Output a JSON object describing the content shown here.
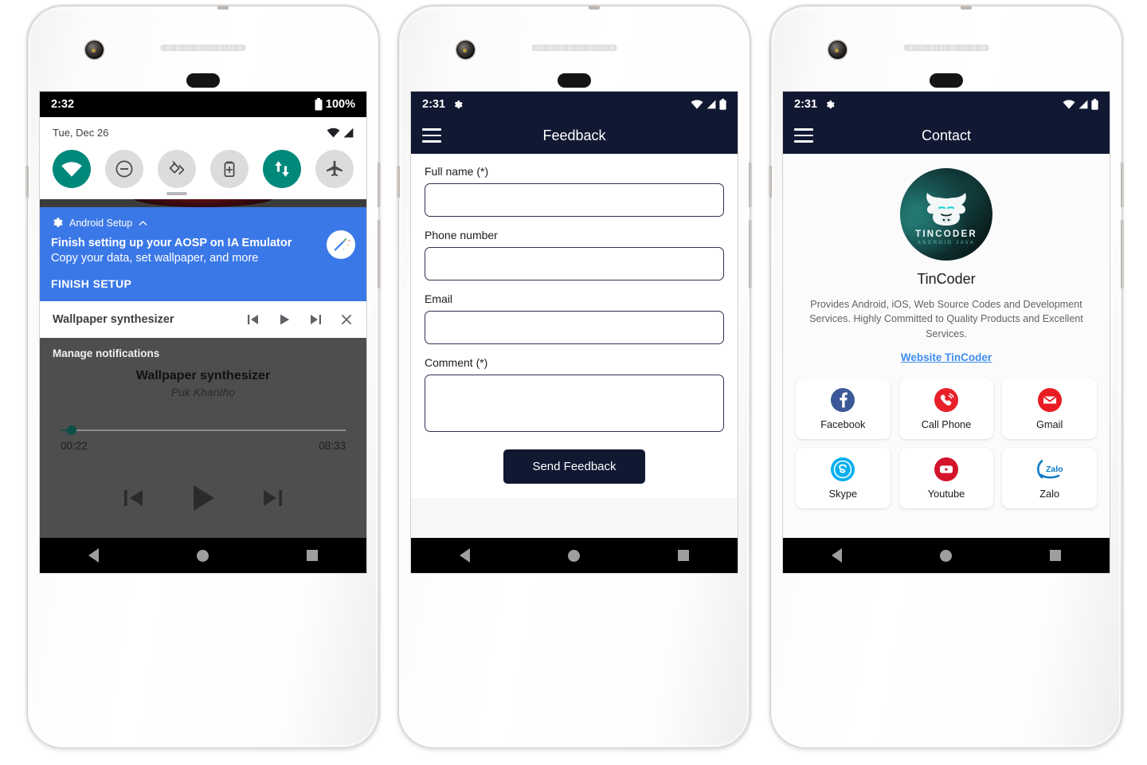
{
  "phone1": {
    "status": {
      "time": "2:32",
      "battery_text": "100%",
      "battery_icon": "battery-full-icon"
    },
    "quick_settings": {
      "date": "Tue, Dec 26",
      "wifi_icon": "wifi-icon",
      "signal_icon": "cell-signal-icon",
      "tiles": [
        {
          "name": "wifi-tile",
          "icon": "wifi-icon",
          "active": true
        },
        {
          "name": "do-not-disturb-tile",
          "icon": "dnd-icon",
          "active": false
        },
        {
          "name": "auto-rotate-tile",
          "icon": "rotate-icon",
          "active": false
        },
        {
          "name": "battery-saver-tile",
          "icon": "battery-plus-icon",
          "active": false
        },
        {
          "name": "mobile-data-tile",
          "icon": "data-arrows-icon",
          "active": true
        },
        {
          "name": "airplane-mode-tile",
          "icon": "airplane-icon",
          "active": false
        }
      ]
    },
    "notification": {
      "app_name": "Android Setup",
      "app_icon": "gear-icon",
      "collapse_icon": "chevron-up-icon",
      "title": "Finish setting up your AOSP on IA Emulator",
      "subtitle": "Copy your data, set wallpaper, and more",
      "action": "FINISH SETUP",
      "thumb_icon": "magic-wand-icon",
      "accent": "#3b78e7"
    },
    "media_notification": {
      "title": "Wallpaper synthesizer",
      "prev_icon": "skip-previous-icon",
      "play_icon": "play-icon",
      "next_icon": "skip-next-icon",
      "close_icon": "close-icon"
    },
    "media_panel": {
      "manage_label": "Manage notifications",
      "track_title": "Wallpaper synthesizer",
      "artist": "Puk Khantho",
      "elapsed": "00:22",
      "duration": "08:33",
      "progress_percent": 4,
      "prev_icon": "skip-previous-icon",
      "play_icon": "play-icon",
      "next_icon": "skip-next-icon",
      "accent": "#0d4f46"
    },
    "navbar": {
      "back_icon": "back-triangle-icon",
      "home_icon": "home-circle-icon",
      "recents_icon": "recents-square-icon"
    }
  },
  "phone2": {
    "status": {
      "time": "2:31",
      "gear_icon": "gear-icon",
      "wifi_icon": "wifi-icon",
      "signal_icon": "cell-signal-icon",
      "battery_icon": "battery-icon"
    },
    "appbar": {
      "menu_icon": "hamburger-menu-icon",
      "title": "Feedback",
      "background": "#101832"
    },
    "form": {
      "fields": [
        {
          "name": "full-name-field",
          "label": "Full name (*)",
          "value": "",
          "placeholder": "",
          "multiline": false
        },
        {
          "name": "phone-number-field",
          "label": "Phone number",
          "value": "",
          "placeholder": "",
          "multiline": false
        },
        {
          "name": "email-field",
          "label": "Email",
          "value": "",
          "placeholder": "",
          "multiline": false
        },
        {
          "name": "comment-field",
          "label": "Comment (*)",
          "value": "",
          "placeholder": "",
          "multiline": true
        }
      ],
      "submit_label": "Send Feedback"
    },
    "navbar": {
      "back_icon": "back-triangle-icon",
      "home_icon": "home-circle-icon",
      "recents_icon": "recents-square-icon"
    }
  },
  "phone3": {
    "status": {
      "time": "2:31",
      "gear_icon": "gear-icon",
      "wifi_icon": "wifi-icon",
      "signal_icon": "cell-signal-icon",
      "battery_icon": "battery-icon"
    },
    "appbar": {
      "menu_icon": "hamburger-menu-icon",
      "title": "Contact",
      "background": "#101832"
    },
    "profile": {
      "logo_icon": "tincoder-bull-logo",
      "logo_text": "TINCODER",
      "logo_subtext": "ANDROID JAVA",
      "name": "TinCoder",
      "description": "Provides Android, iOS, Web Source Codes and Development Services. Highly Committed to Quality Products and Excellent Services.",
      "link_label": "Website TinCoder",
      "link_color": "#3f8cf0"
    },
    "contacts": [
      {
        "name": "facebook-cell",
        "label": "Facebook",
        "icon": "facebook-icon",
        "color": "#3b5998"
      },
      {
        "name": "call-phone-cell",
        "label": "Call Phone",
        "icon": "phone-icon",
        "color": "#e8202a"
      },
      {
        "name": "gmail-cell",
        "label": "Gmail",
        "icon": "gmail-icon",
        "color": "#ea1c23"
      },
      {
        "name": "skype-cell",
        "label": "Skype",
        "icon": "skype-icon",
        "color": "#00aff0"
      },
      {
        "name": "youtube-cell",
        "label": "Youtube",
        "icon": "youtube-icon",
        "color": "#d3142a"
      },
      {
        "name": "zalo-cell",
        "label": "Zalo",
        "icon": "zalo-icon",
        "color": "#0f7ac7"
      }
    ],
    "navbar": {
      "back_icon": "back-triangle-icon",
      "home_icon": "home-circle-icon",
      "recents_icon": "recents-square-icon"
    }
  }
}
